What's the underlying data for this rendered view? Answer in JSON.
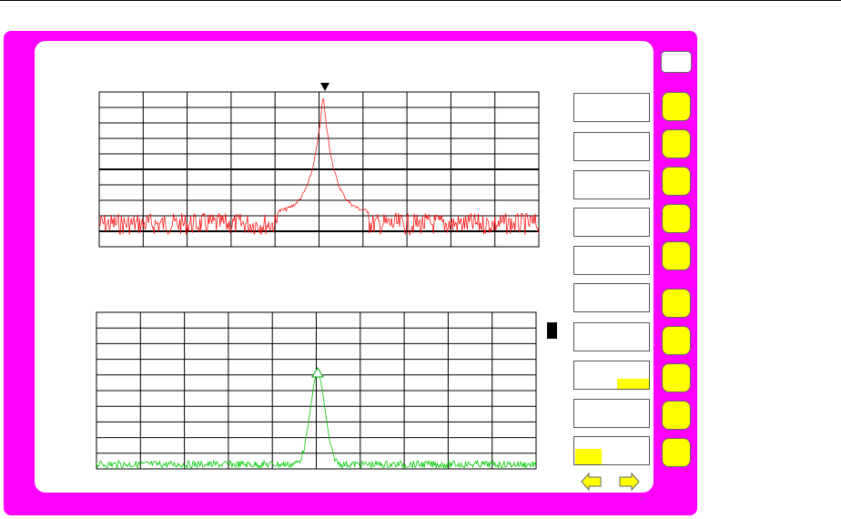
{
  "colors": {
    "frame": "#ff00ff",
    "softkey": "#ffff00",
    "upper_trace": "#ff0000",
    "lower_trace": "#00cc00",
    "highlight": "#ffff00"
  },
  "top_button_icon": "blank-key",
  "softkeys_count": 10,
  "label_boxes": [
    {
      "text": "",
      "highlight": "none"
    },
    {
      "text": "",
      "highlight": "none"
    },
    {
      "text": "",
      "highlight": "none"
    },
    {
      "text": "",
      "highlight": "none"
    },
    {
      "text": "",
      "highlight": "none"
    },
    {
      "text": "",
      "highlight": "none"
    },
    {
      "text": "",
      "highlight": "none"
    },
    {
      "text": "",
      "highlight": "bottom-right"
    },
    {
      "text": "",
      "highlight": "none"
    },
    {
      "text": "",
      "highlight": "top-left"
    }
  ],
  "nav": {
    "prev_icon": "arrow-left-icon",
    "next_icon": "arrow-right-icon"
  },
  "upper_display": {
    "marker_icon": "filled-triangle-marker-icon",
    "trace": "red-spectrum"
  },
  "lower_display": {
    "marker_icon": "hollow-triangle-marker-icon",
    "trace": "green-spectrum"
  }
}
